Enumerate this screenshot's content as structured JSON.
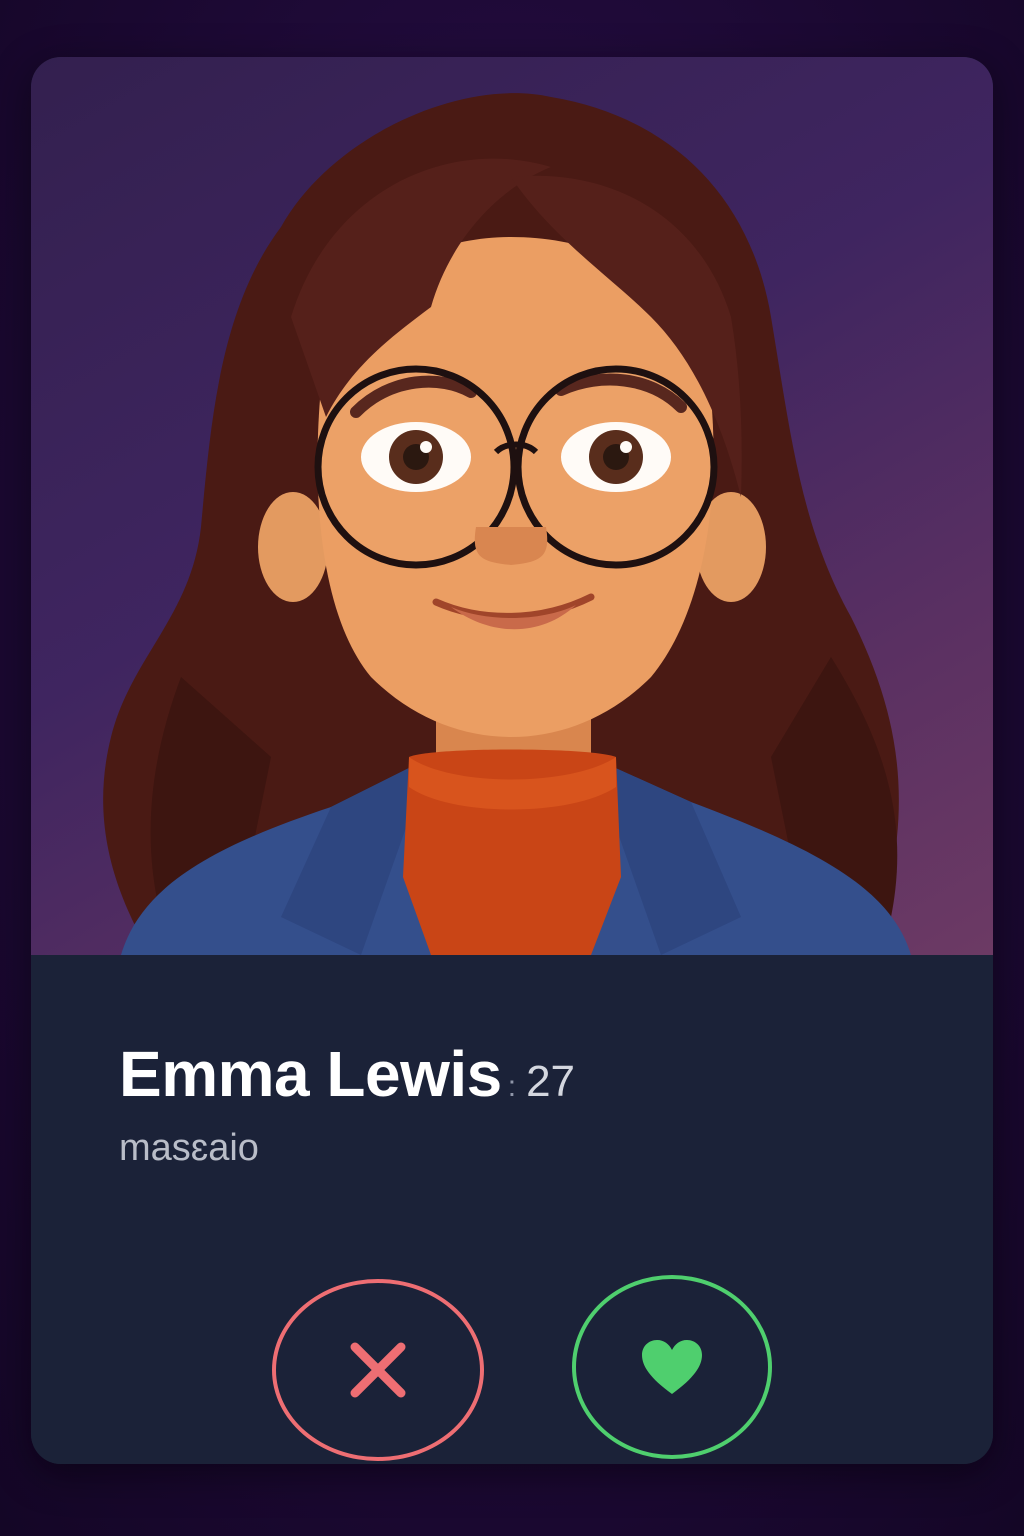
{
  "profile": {
    "name": "Emma Lewis",
    "separator": ":",
    "age": "27",
    "subtitle": "masɛaio",
    "photo_icon": "illustrated-portrait"
  },
  "actions": {
    "pass": {
      "icon": "x-icon",
      "color": "#ee6e73"
    },
    "like": {
      "icon": "heart-icon",
      "color": "#4fcf6e"
    }
  },
  "colors": {
    "page_background": "#1f0a38",
    "card_info_background": "#1b2238",
    "name_text": "#ffffff"
  }
}
